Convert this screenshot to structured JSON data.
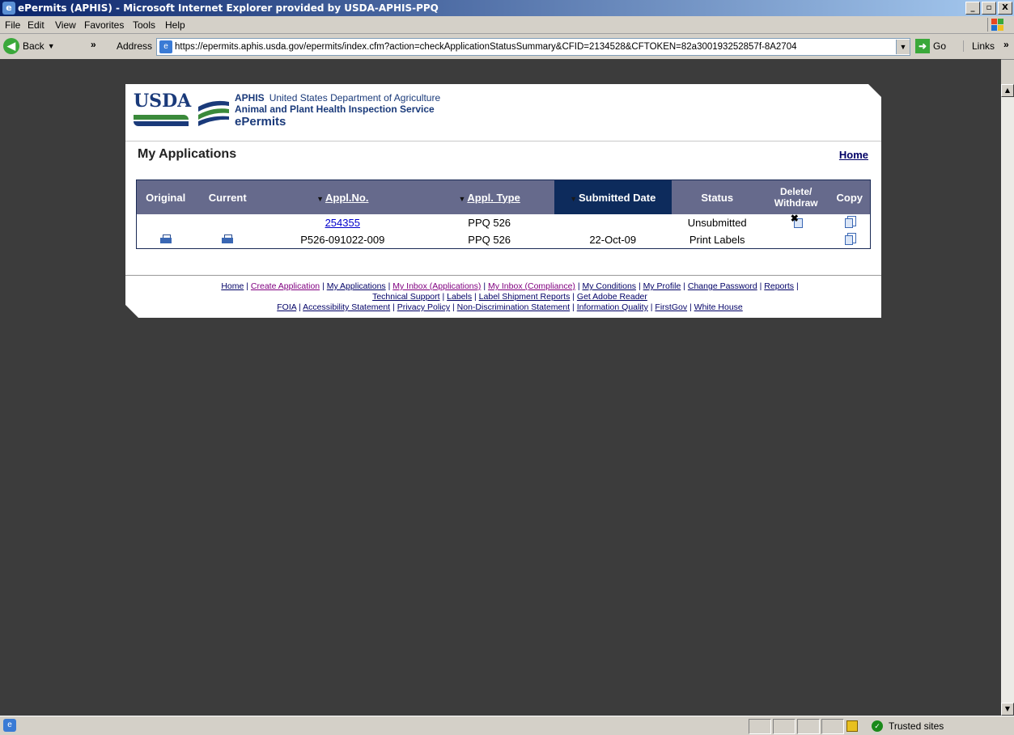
{
  "window": {
    "title": "ePermits (APHIS) - Microsoft Internet Explorer provided by USDA-APHIS-PPQ",
    "controls": [
      "_",
      "▫",
      "X"
    ]
  },
  "menubar": {
    "items": [
      "File",
      "Edit",
      "View",
      "Favorites",
      "Tools",
      "Help"
    ]
  },
  "toolbar": {
    "back_label": "Back",
    "address_label": "Address",
    "url": "https://epermits.aphis.usda.gov/epermits/index.cfm?action=checkApplicationStatusSummary&CFID=2134528&CFTOKEN=82a300193252857f-8A2704",
    "go_label": "Go",
    "links_label": "Links"
  },
  "header": {
    "usda": "USDA",
    "aphis": "APHIS",
    "dept": "United States Department of Agriculture",
    "service": "Animal and Plant Health Inspection Service",
    "app": "ePermits",
    "colors": {
      "navy": "#1a3a7a",
      "green": "#3a8a3a"
    }
  },
  "page": {
    "title": "My Applications",
    "home_link": "Home"
  },
  "table": {
    "columns": [
      {
        "label": "Original",
        "sortable": false
      },
      {
        "label": "Current",
        "sortable": false
      },
      {
        "label": "Appl.No.",
        "sortable": true
      },
      {
        "label": "Appl. Type",
        "sortable": true
      },
      {
        "label": "Submitted Date",
        "sortable": true,
        "sorted": true
      },
      {
        "label": "Status",
        "sortable": false
      },
      {
        "label": "Delete/",
        "label2": "Withdraw",
        "sortable": false
      },
      {
        "label": "Copy",
        "sortable": false
      }
    ],
    "rows": [
      {
        "original": "",
        "current": "",
        "appl_no": "254355",
        "appl_no_link": true,
        "type": "PPQ 526",
        "submitted": "",
        "status": "Unsubmitted",
        "delete": true,
        "copy": true
      },
      {
        "original": "print",
        "current": "print",
        "appl_no": "P526-091022-009",
        "appl_no_link": false,
        "type": "PPQ 526",
        "submitted": "22-Oct-09",
        "status": "Print Labels",
        "delete": false,
        "copy": true
      }
    ]
  },
  "footer": {
    "line1": [
      "Home",
      "Create Application",
      "My Applications",
      "My Inbox (Applications)",
      "My Inbox (Compliance)",
      "My Conditions",
      "My Profile",
      "Change Password",
      "Reports"
    ],
    "line2": [
      "Technical Support",
      "Labels",
      "Label Shipment Reports",
      "Get Adobe Reader"
    ],
    "line3": [
      "FOIA",
      "Accessibility Statement",
      "Privacy Policy",
      "Non-Discrimination Statement",
      "Information Quality",
      "FirstGov",
      "White House"
    ]
  },
  "statusbar": {
    "zone": "Trusted sites"
  }
}
